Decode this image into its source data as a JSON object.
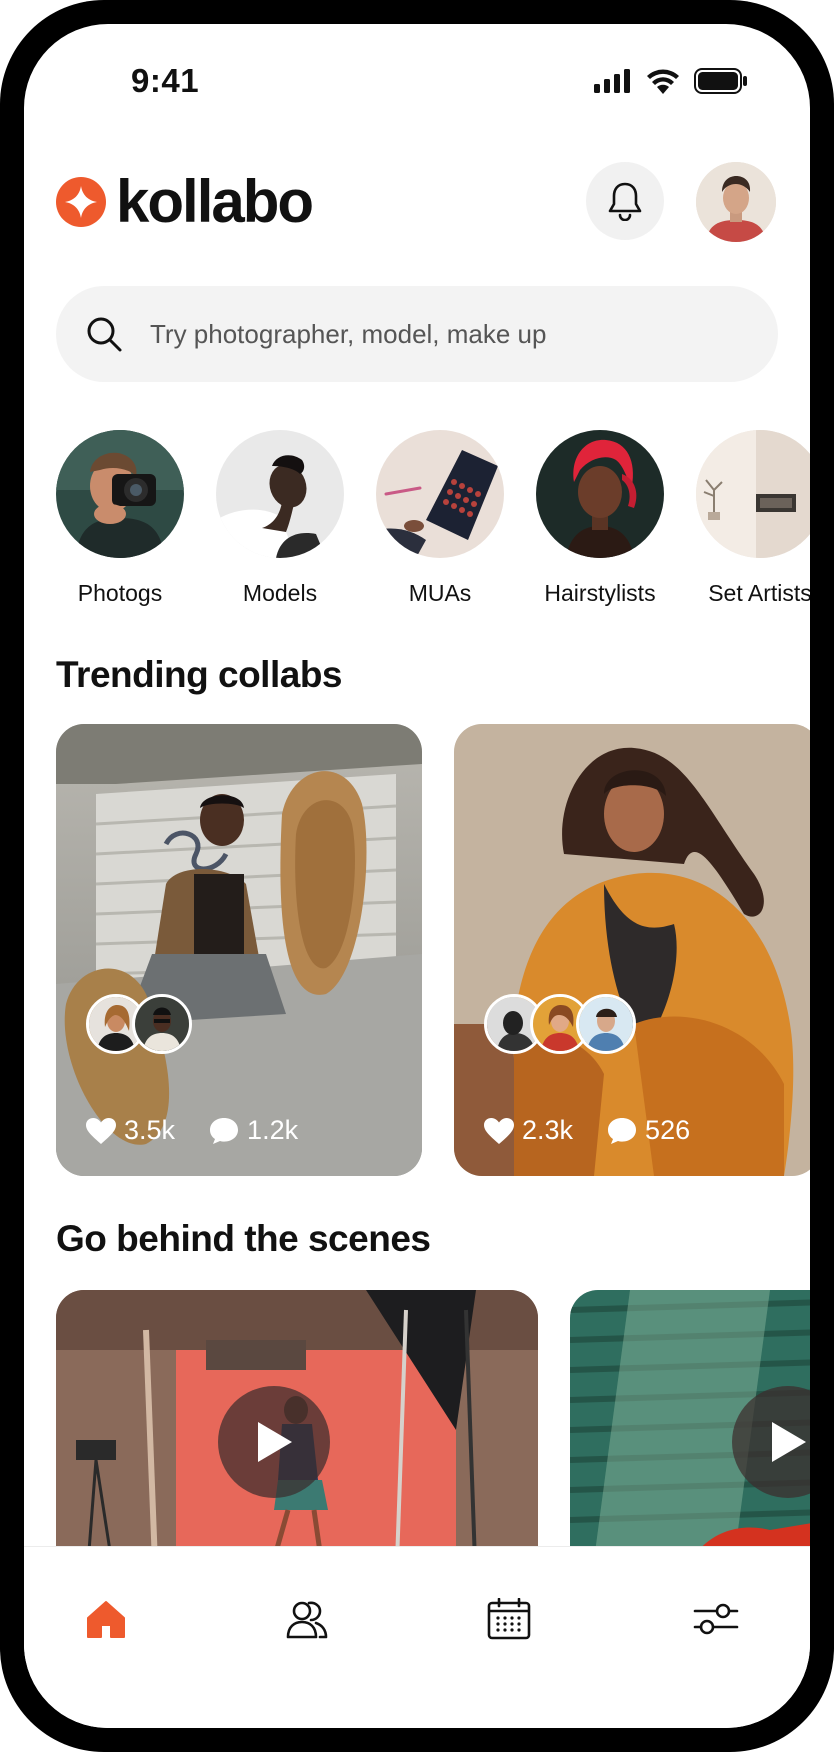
{
  "status_bar": {
    "time": "9:41"
  },
  "header": {
    "brand": "kollabo",
    "accent_color": "#ee5a2d",
    "icons": [
      "bell-icon",
      "profile-avatar"
    ]
  },
  "search": {
    "placeholder": "Try photographer, model, make up",
    "value": ""
  },
  "categories": [
    {
      "label": "Photogs"
    },
    {
      "label": "Models"
    },
    {
      "label": "MUAs"
    },
    {
      "label": "Hairstylists"
    },
    {
      "label": "Set Artists"
    }
  ],
  "trending": {
    "title": "Trending collabs",
    "cards": [
      {
        "likes": "3.5k",
        "comments": "1.2k",
        "collaborators": 2
      },
      {
        "likes": "2.3k",
        "comments": "526",
        "collaborators": 3
      }
    ]
  },
  "behind_scenes": {
    "title": "Go behind the scenes",
    "icons": [
      "play-icon",
      "play-icon"
    ]
  },
  "bottom_nav": {
    "active": "home",
    "icons": [
      "home-icon",
      "people-icon",
      "calendar-icon",
      "sliders-icon"
    ]
  }
}
